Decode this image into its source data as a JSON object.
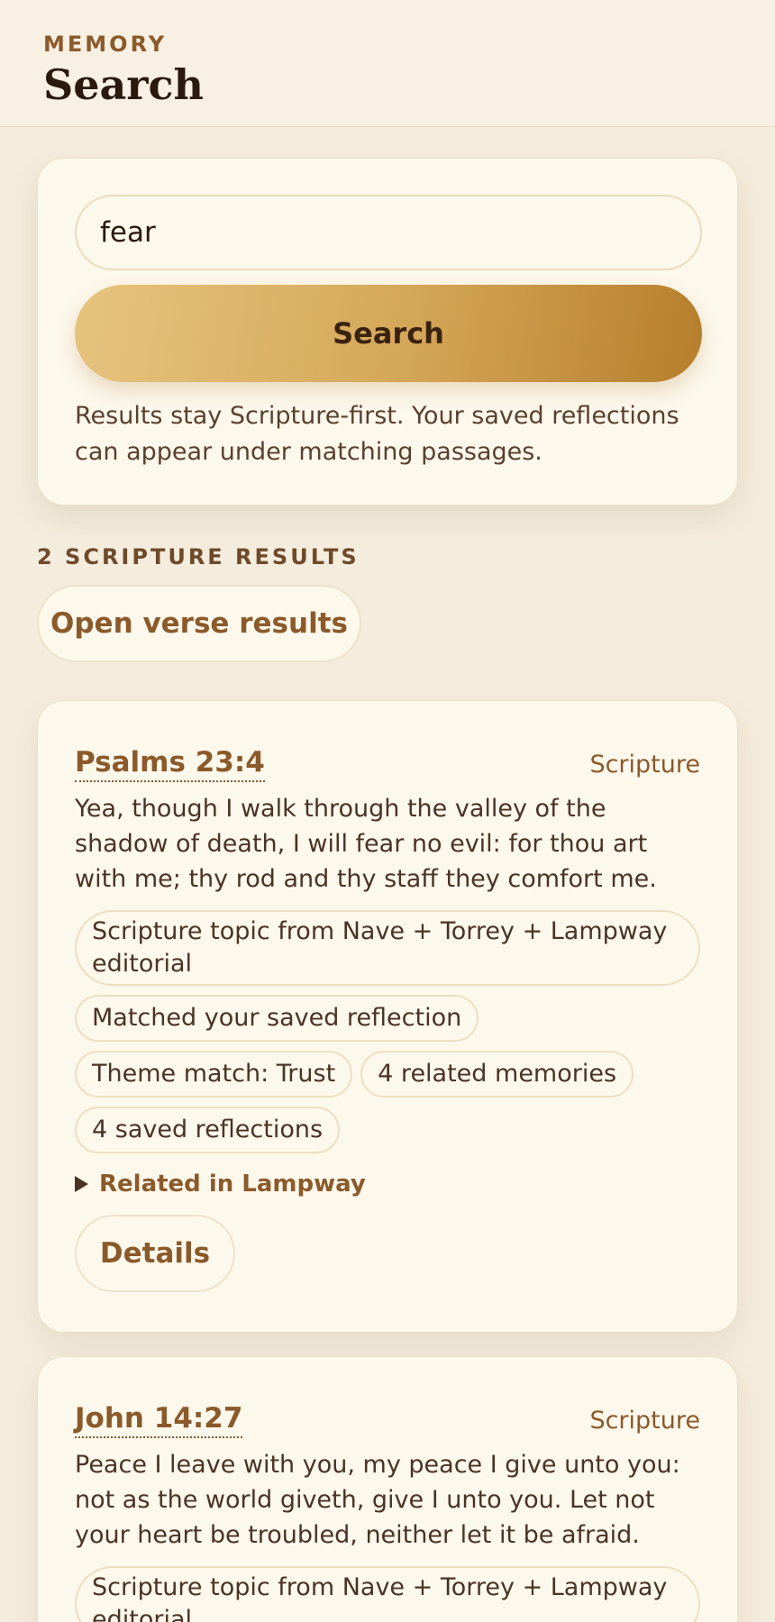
{
  "header": {
    "eyebrow": "MEMORY",
    "title": "Search"
  },
  "search": {
    "query": "fear",
    "button_label": "Search",
    "helper_text": "Results stay Scripture-first. Your saved reflections can appear under matching passages."
  },
  "results": {
    "count_label": "2 SCRIPTURE RESULTS",
    "open_button_label": "Open verse results",
    "items": [
      {
        "reference": "Psalms 23:4",
        "source": "Scripture",
        "text": "Yea, though I walk through the valley of the shadow of death, I will fear no evil: for thou art with me; thy rod and thy staff they comfort me.",
        "tags": [
          "Scripture topic from Nave + Torrey + Lampway editorial",
          "Matched your saved reflection",
          "Theme match: Trust",
          "4 related memories",
          "4 saved reflections"
        ],
        "related_label": "Related in Lampway",
        "details_label": "Details"
      },
      {
        "reference": "John 14:27",
        "source": "Scripture",
        "text": "Peace I leave with you, my peace I give unto you: not as the world giveth, give I unto you. Let not your heart be troubled, neither let it be afraid.",
        "tags": [
          "Scripture topic from Nave + Torrey + Lampway editorial"
        ]
      }
    ]
  },
  "colors": {
    "background": "#f4ecdd",
    "card": "#fdf8ec",
    "accent": "#8b5a2b",
    "button_gradient_start": "#e6c47e",
    "button_gradient_end": "#b67e2c"
  }
}
